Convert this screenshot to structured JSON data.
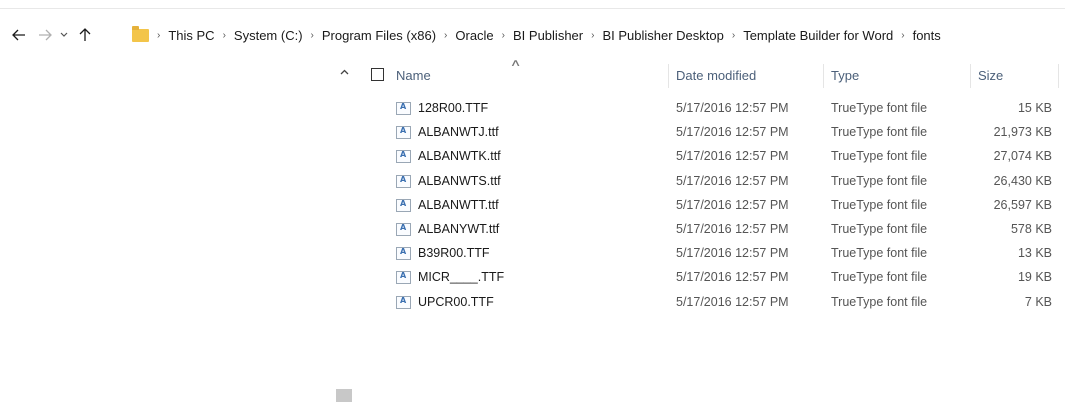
{
  "navigation": {
    "back_icon": "arrow-left-icon",
    "forward_icon": "arrow-right-icon",
    "recent_icon": "chevron-down-icon",
    "up_icon": "arrow-up-icon"
  },
  "breadcrumb": [
    "This PC",
    "System (C:)",
    "Program Files (x86)",
    "Oracle",
    "BI Publisher",
    "BI Publisher Desktop",
    "Template Builder for Word",
    "fonts"
  ],
  "columns": {
    "name": "Name",
    "date": "Date modified",
    "type": "Type",
    "size": "Size"
  },
  "files": [
    {
      "name": "128R00.TTF",
      "date": "5/17/2016 12:57 PM",
      "type": "TrueType font file",
      "size": "15 KB"
    },
    {
      "name": "ALBANWTJ.ttf",
      "date": "5/17/2016 12:57 PM",
      "type": "TrueType font file",
      "size": "21,973 KB"
    },
    {
      "name": "ALBANWTK.ttf",
      "date": "5/17/2016 12:57 PM",
      "type": "TrueType font file",
      "size": "27,074 KB"
    },
    {
      "name": "ALBANWTS.ttf",
      "date": "5/17/2016 12:57 PM",
      "type": "TrueType font file",
      "size": "26,430 KB"
    },
    {
      "name": "ALBANWTT.ttf",
      "date": "5/17/2016 12:57 PM",
      "type": "TrueType font file",
      "size": "26,597 KB"
    },
    {
      "name": "ALBANYWT.ttf",
      "date": "5/17/2016 12:57 PM",
      "type": "TrueType font file",
      "size": "578 KB"
    },
    {
      "name": "B39R00.TTF",
      "date": "5/17/2016 12:57 PM",
      "type": "TrueType font file",
      "size": "13 KB"
    },
    {
      "name": "MICR____.TTF",
      "date": "5/17/2016 12:57 PM",
      "type": "TrueType font file",
      "size": "19 KB"
    },
    {
      "name": "UPCR00.TTF",
      "date": "5/17/2016 12:57 PM",
      "type": "TrueType font file",
      "size": "7 KB"
    }
  ],
  "colors": {
    "header_text": "#4c607a",
    "folder": "#f3c54a"
  }
}
